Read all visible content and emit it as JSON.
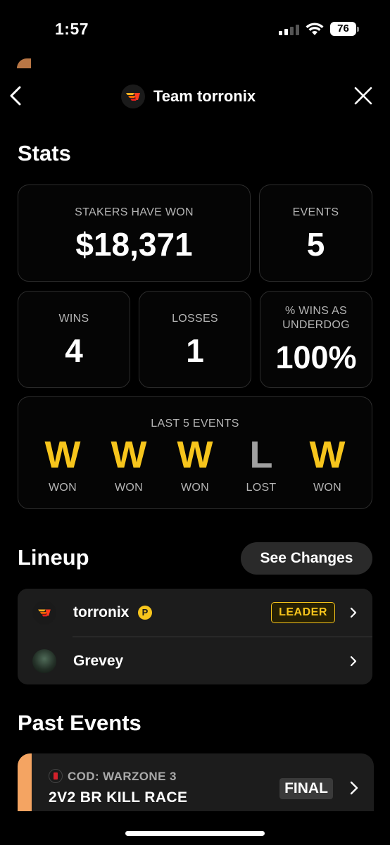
{
  "status_bar": {
    "time": "1:57",
    "battery": "76"
  },
  "header": {
    "title": "Team torronix"
  },
  "stats": {
    "title": "Stats",
    "stakers_label": "STAKERS HAVE WON",
    "stakers_value": "$18,371",
    "events_label": "EVENTS",
    "events_value": "5",
    "wins_label": "WINS",
    "wins_value": "4",
    "losses_label": "LOSSES",
    "losses_value": "1",
    "underdog_label_line1": "% WINS AS",
    "underdog_label_line2": "UNDERDOG",
    "underdog_value": "100%",
    "last5_label": "LAST 5 EVENTS",
    "last5": [
      {
        "letter": "W",
        "caption": "WON"
      },
      {
        "letter": "W",
        "caption": "WON"
      },
      {
        "letter": "W",
        "caption": "WON"
      },
      {
        "letter": "L",
        "caption": "LOST"
      },
      {
        "letter": "W",
        "caption": "WON"
      }
    ]
  },
  "lineup": {
    "title": "Lineup",
    "see_changes_label": "See Changes",
    "members": [
      {
        "name": "torronix",
        "badge": "P",
        "role": "LEADER"
      },
      {
        "name": "Grevey"
      }
    ]
  },
  "past_events": {
    "title": "Past Events",
    "events": [
      {
        "game": "COD: WARZONE 3",
        "name": "2V2 BR KILL RACE",
        "status": "FINAL"
      }
    ]
  },
  "colors": {
    "win": "#f7c51c",
    "loss": "#a0a0a0",
    "accent": "#f4a462"
  }
}
